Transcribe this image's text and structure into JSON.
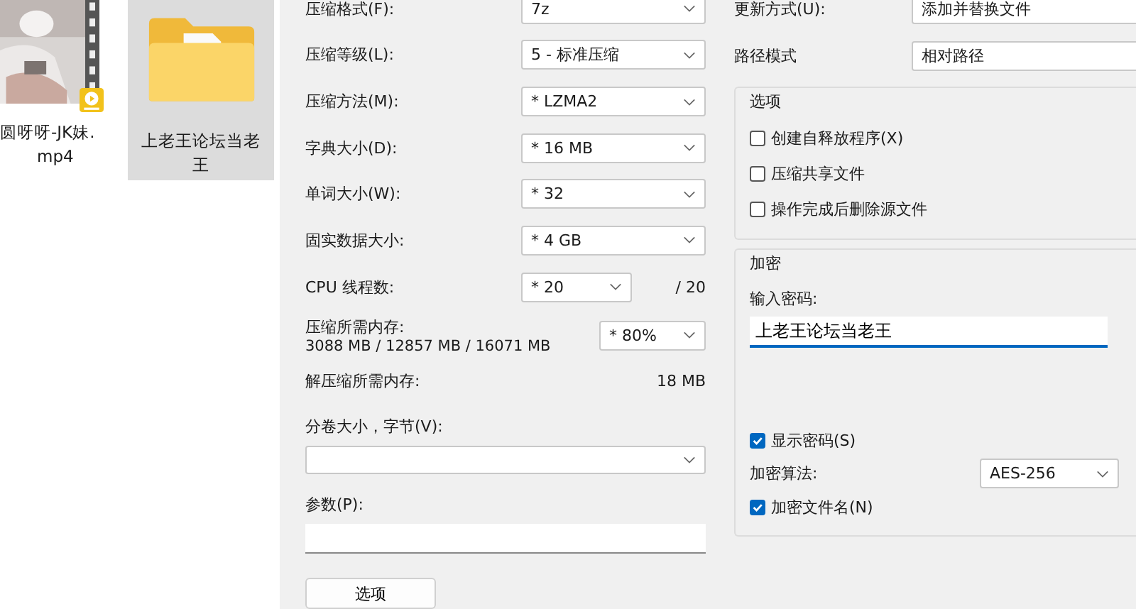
{
  "explorer": {
    "files": [
      {
        "kind": "video",
        "name_lines": [
          "圆呀呀-JK妹.",
          "mp4"
        ],
        "selected": false
      },
      {
        "kind": "folder",
        "name_lines": [
          "上老王论坛当老",
          "王"
        ],
        "selected": true
      }
    ]
  },
  "settings": [
    {
      "label": "压缩格式(F):",
      "value": "7z"
    },
    {
      "label": "压缩等级(L):",
      "value": "5 - 标准压缩"
    },
    {
      "label": "压缩方法(M):",
      "value": "* LZMA2"
    },
    {
      "label": "字典大小(D):",
      "value": "* 16 MB"
    },
    {
      "label": "单词大小(W):",
      "value": "* 32"
    },
    {
      "label": "固实数据大小:",
      "value": "* 4 GB"
    }
  ],
  "threads": {
    "label": "CPU 线程数:",
    "value": "* 20",
    "max": "/ 20"
  },
  "memory": {
    "label": "压缩所需内存:",
    "detail": "3088 MB / 12857 MB / 16071 MB",
    "value": "* 80%"
  },
  "decompress_memory": {
    "label": "解压缩所需内存:",
    "value": "18 MB"
  },
  "volume": {
    "label": "分卷大小，字节(V):"
  },
  "parameters": {
    "label": "参数(P):"
  },
  "options_button": "选项",
  "update_mode": {
    "label": "更新方式(U):",
    "value": "添加并替换文件"
  },
  "path_mode": {
    "label": "路径模式",
    "value": "相对路径"
  },
  "options_group": {
    "title": "选项",
    "checkboxes": [
      {
        "label": "创建自释放程序(X)",
        "checked": false
      },
      {
        "label": "压缩共享文件",
        "checked": false
      },
      {
        "label": "操作完成后删除源文件",
        "checked": false
      }
    ]
  },
  "encryption": {
    "title": "加密",
    "password_label": "输入密码:",
    "password": "上老王论坛当老王",
    "show_password": {
      "label": "显示密码(S)",
      "checked": true
    },
    "method_label": "加密算法:",
    "method": "AES-256",
    "encrypt_names": {
      "label": "加密文件名(N)",
      "checked": true
    }
  }
}
